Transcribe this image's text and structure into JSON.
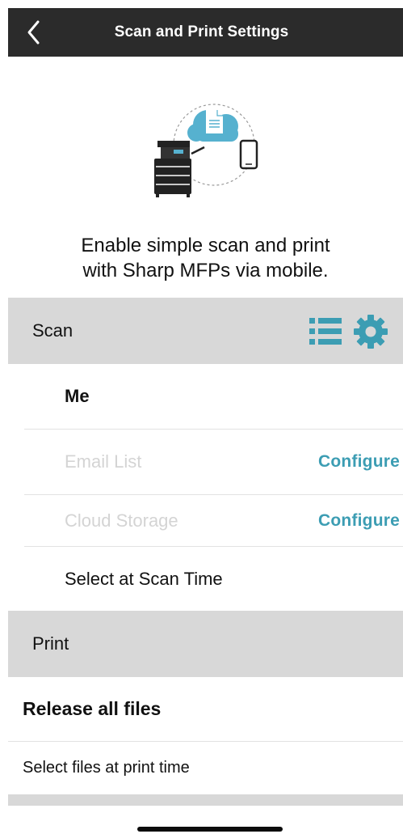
{
  "header": {
    "title": "Scan and Print Settings",
    "back_icon": "chevron-left-icon"
  },
  "hero": {
    "illustration": "mfp-cloud-phone-illustration",
    "tagline_line1": "Enable simple scan and print",
    "tagline_line2": "with Sharp MFPs via mobile."
  },
  "scan": {
    "label": "Scan",
    "icons": [
      "list-icon",
      "gear-icon"
    ],
    "items": [
      {
        "label": "Me",
        "enabled": true,
        "bold": true
      },
      {
        "label": "Email List",
        "enabled": false,
        "action": "Configure"
      },
      {
        "label": "Cloud Storage",
        "enabled": false,
        "action": "Configure"
      },
      {
        "label": "Select at Scan Time",
        "enabled": true
      }
    ]
  },
  "print": {
    "label": "Print",
    "items": [
      {
        "label": "Release all files",
        "bold": true
      },
      {
        "label": "Select files at print time"
      }
    ]
  },
  "colors": {
    "accent": "#3c9db3",
    "header_bg": "#2b2b2b",
    "section_bg": "#d8d8d8",
    "disabled_text": "#d4d4d4"
  }
}
